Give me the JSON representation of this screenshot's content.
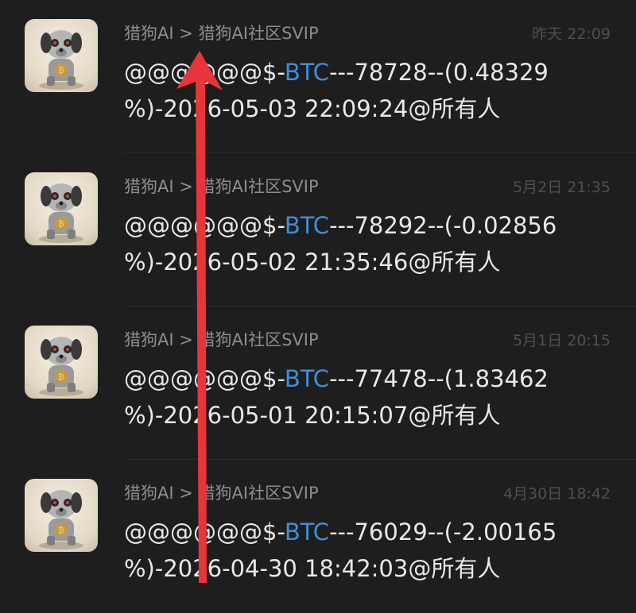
{
  "messages": [
    {
      "sender": "猎狗AI > 猎狗AI社区SVIP",
      "time": "昨天 22:09",
      "prefix": "@@@@@@$-",
      "coin": "BTC",
      "tail1": "---78728--(0.48329",
      "line2": "%)-2026-05-03 22:09:24@所有人"
    },
    {
      "sender": "猎狗AI > 猎狗AI社区SVIP",
      "time": "5月2日 21:35",
      "prefix": "@@@@@@$-",
      "coin": "BTC",
      "tail1": "---78292--(-0.02856",
      "line2": "%)-2026-05-02 21:35:46@所有人"
    },
    {
      "sender": "猎狗AI > 猎狗AI社区SVIP",
      "time": "5月1日 20:15",
      "prefix": "@@@@@@$-",
      "coin": "BTC",
      "tail1": "---77478--(1.83462",
      "line2": "%)-2026-05-01 20:15:07@所有人"
    },
    {
      "sender": "猎狗AI > 猎狗AI社区SVIP",
      "time": "4月30日 18:42",
      "prefix": "@@@@@@$-",
      "coin": "BTC",
      "tail1": "---76029--(-2.00165",
      "line2": "%)-2026-04-30 18:42:03@所有人"
    }
  ],
  "colors": {
    "background": "#1e1e1e",
    "coin_link": "#3f8fd8",
    "arrow": "#e8353a"
  },
  "icons": {
    "avatar": "robot-dog-bitcoin-icon",
    "overlay": "red-up-arrow"
  }
}
